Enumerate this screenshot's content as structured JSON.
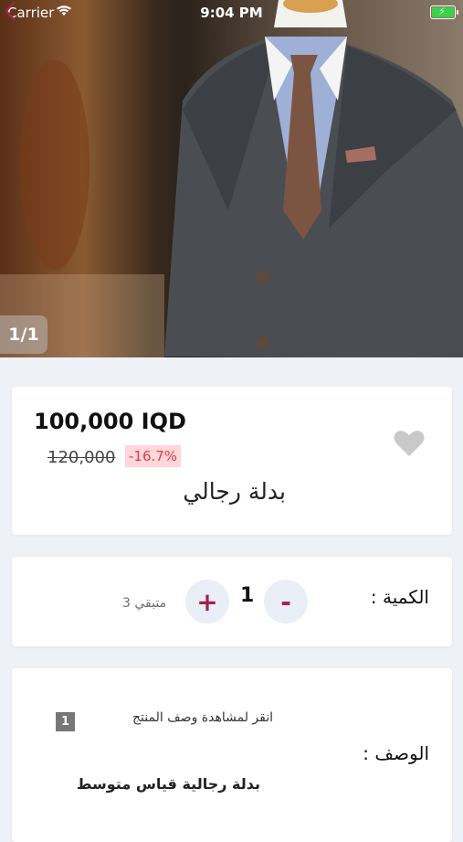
{
  "status_bar": {
    "carrier": "Carrier",
    "time": "9:04 PM"
  },
  "gallery": {
    "counter": "1/1"
  },
  "product": {
    "price": "100,000 IQD",
    "old_price": "120,000",
    "discount": "-16.7%",
    "name": "بدلة رجالي"
  },
  "quantity": {
    "label": "الكمية :",
    "minus": "-",
    "plus": "+",
    "value": "1",
    "stock": "متبقي 3"
  },
  "description": {
    "hint": "انقر لمشاهدة وصف المنتج",
    "badge": "1",
    "label": "الوصف :",
    "text": "بدلة رجالية  قياس متوسط"
  },
  "colors": {
    "accent": "#a3244a",
    "discount_bg": "#ffd6da",
    "discount_text": "#e43a45"
  }
}
